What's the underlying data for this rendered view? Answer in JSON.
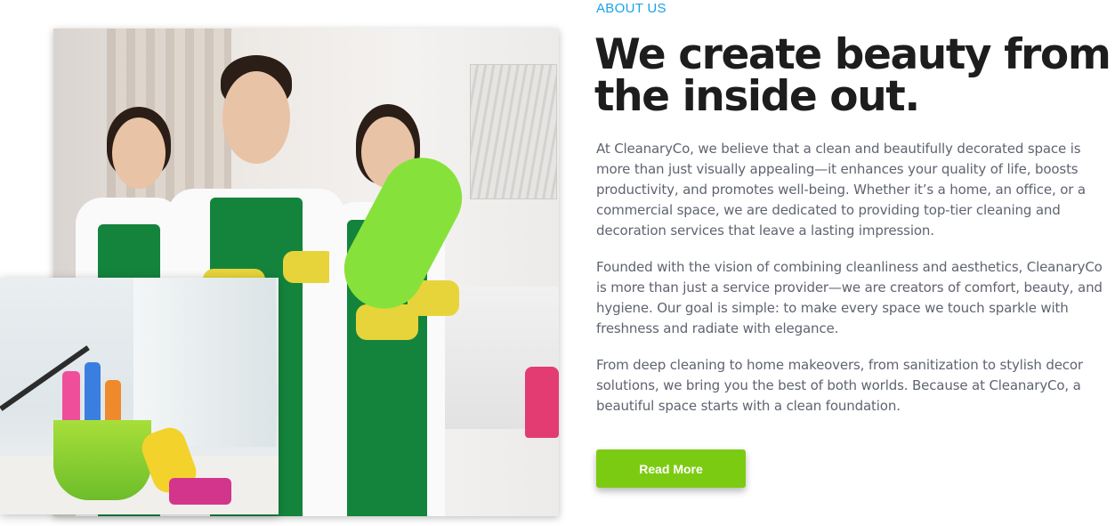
{
  "about": {
    "eyebrow": "ABOUT US",
    "title": "We create beauty from the inside out.",
    "paragraphs": [
      "At CleanaryCo, we believe that a clean and beautifully decorated space is more than just visually appealing—it enhances your quality of life, boosts productivity, and promotes well-being. Whether it’s a home, an office, or a commercial space, we are dedicated to providing top-tier cleaning and decoration services that leave a lasting impression.",
      "Founded with the vision of combining cleanliness and aesthetics, CleanaryCo is more than just a service provider—we are creators of comfort, beauty, and hygiene. Our goal is simple: to make every space we touch sparkle with freshness and radiate with elegance.",
      "From deep cleaning to home makeovers, from sanitization to stylish decor solutions, we bring you the best of both worlds. Because at CleanaryCo, a beautiful space starts with a clean foundation."
    ],
    "button_label": "Read More"
  },
  "colors": {
    "eyebrow": "#1aa3e8",
    "title": "#1d1d1d",
    "body_text": "#5f6470",
    "button_bg": "#7ccb13",
    "button_text": "#ffffff"
  }
}
